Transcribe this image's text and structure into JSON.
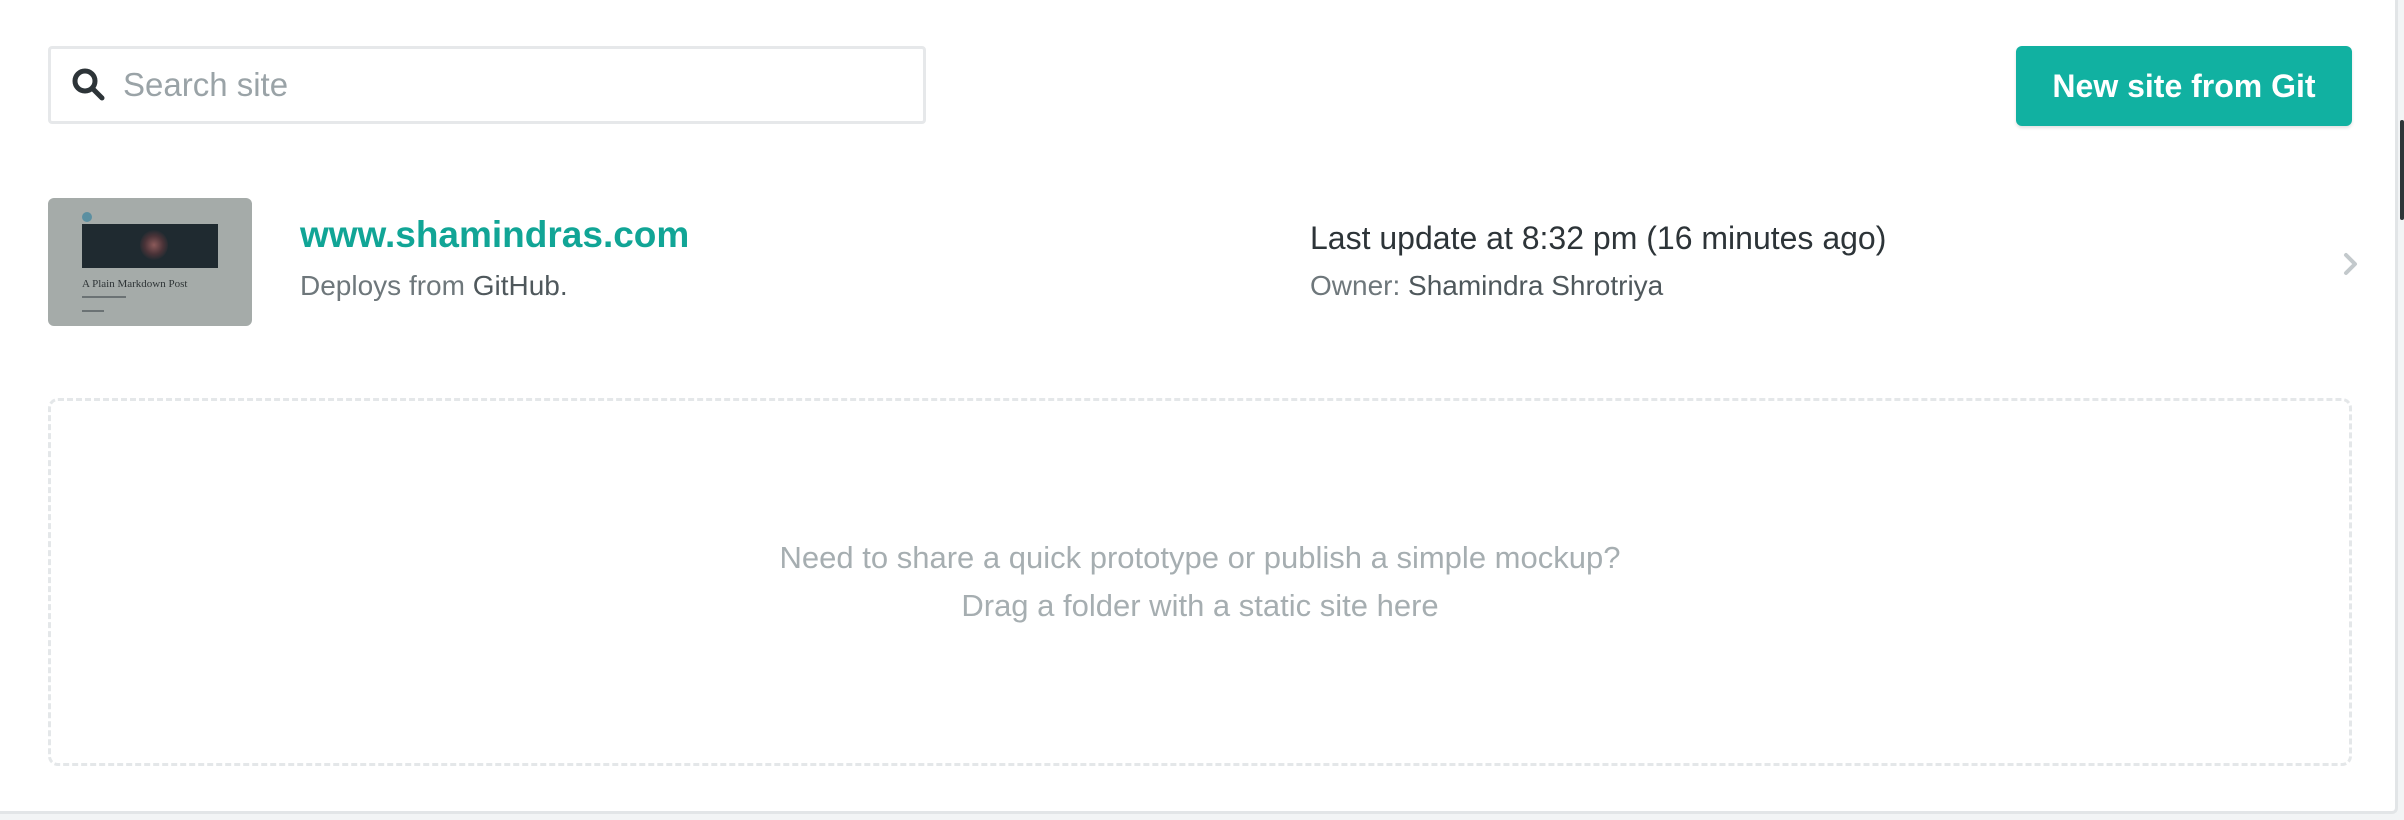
{
  "search": {
    "placeholder": "Search site",
    "value": "",
    "icon": "search-icon"
  },
  "header": {
    "new_site_label": "New site from Git",
    "accent_color": "#11b1a1"
  },
  "sites": [
    {
      "name": "www.shamindras.com",
      "deploy_prefix": "Deploys from",
      "deploy_source": "GitHub.",
      "last_update": "Last update at 8:32 pm (16 minutes ago)",
      "owner_label": "Owner:",
      "owner_name": "Shamindra Shrotriya",
      "thumbnail": {
        "title": "A Plain Markdown Post"
      }
    }
  ],
  "dropzone": {
    "line1": "Need to share a quick prototype or publish a simple mockup?",
    "line2": "Drag a folder with a static site here"
  }
}
